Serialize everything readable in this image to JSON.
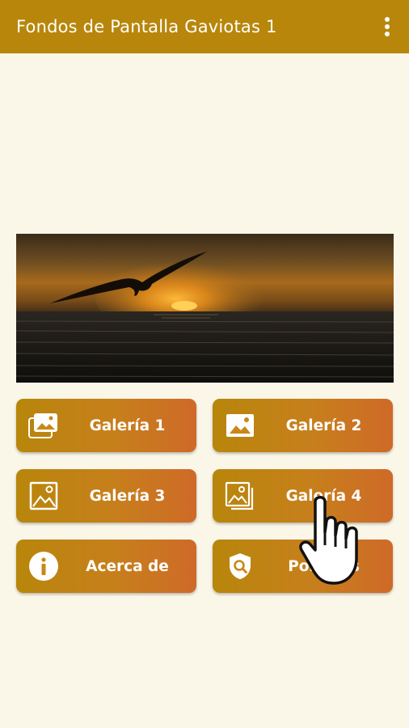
{
  "appbar": {
    "title": "Fondos de Pantalla Gaviotas 1",
    "menu_icon": "more-vert-icon",
    "color": "#b8860b"
  },
  "banner": {
    "description_icon": "seagull-sunset-image"
  },
  "buttons": [
    {
      "label": "Galería 1",
      "icon": "photos-stack-icon"
    },
    {
      "label": "Galería 2",
      "icon": "image-icon"
    },
    {
      "label": "Galería 3",
      "icon": "image-outline-icon"
    },
    {
      "label": "Galería 4",
      "icon": "image-stack-icon"
    },
    {
      "label": "Acerca de",
      "icon": "info-icon"
    },
    {
      "label": "Políticas",
      "icon": "shield-search-icon"
    }
  ],
  "colors": {
    "background": "#faf7e9",
    "button_start": "#b8860b",
    "button_end": "#cf6a28"
  }
}
